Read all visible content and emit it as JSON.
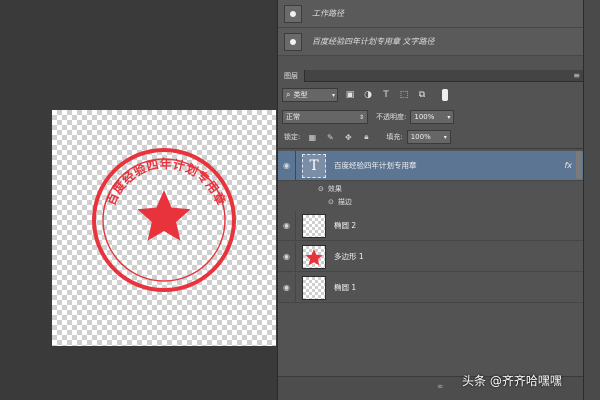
{
  "history": {
    "items": [
      {
        "label": "工作路径"
      },
      {
        "label": "百度经验四年计划专用章 文字路径"
      }
    ]
  },
  "layers_panel": {
    "tab_label": "图层",
    "filter_kind": "类型",
    "blend_mode": "正常",
    "opacity_label": "不透明度:",
    "opacity_value": "100%",
    "lock_label": "锁定:",
    "fill_label": "填充:",
    "fill_value": "100%",
    "layers": [
      {
        "name": "百度经验四年计划专用章",
        "kind": "text",
        "selected": true,
        "fx": "fx",
        "thumb_glyph": "T"
      },
      {
        "name": "椭圆 2",
        "kind": "shape"
      },
      {
        "name": "多边形 1",
        "kind": "shape"
      },
      {
        "name": "椭圆 1",
        "kind": "shape"
      }
    ],
    "effects": {
      "label": "效果",
      "stroke_label": "描边"
    }
  },
  "canvas": {
    "stamp_text": "百度经验四年计划专用章",
    "stamp_color": "#e8323c"
  },
  "watermark": "头条 @齐齐哈嘿嘿",
  "colors": {
    "panel": "#535353",
    "selected_layer": "#5b7593",
    "stamp": "#e8323c"
  },
  "icons": {
    "filter_icons": [
      "image-filter-icon",
      "adjustment-filter-icon",
      "type-filter-icon",
      "shape-filter-icon",
      "smart-object-filter-icon"
    ],
    "lock_icons": [
      "lock-pixels-icon",
      "lock-image-icon",
      "lock-position-icon",
      "lock-all-icon"
    ]
  }
}
